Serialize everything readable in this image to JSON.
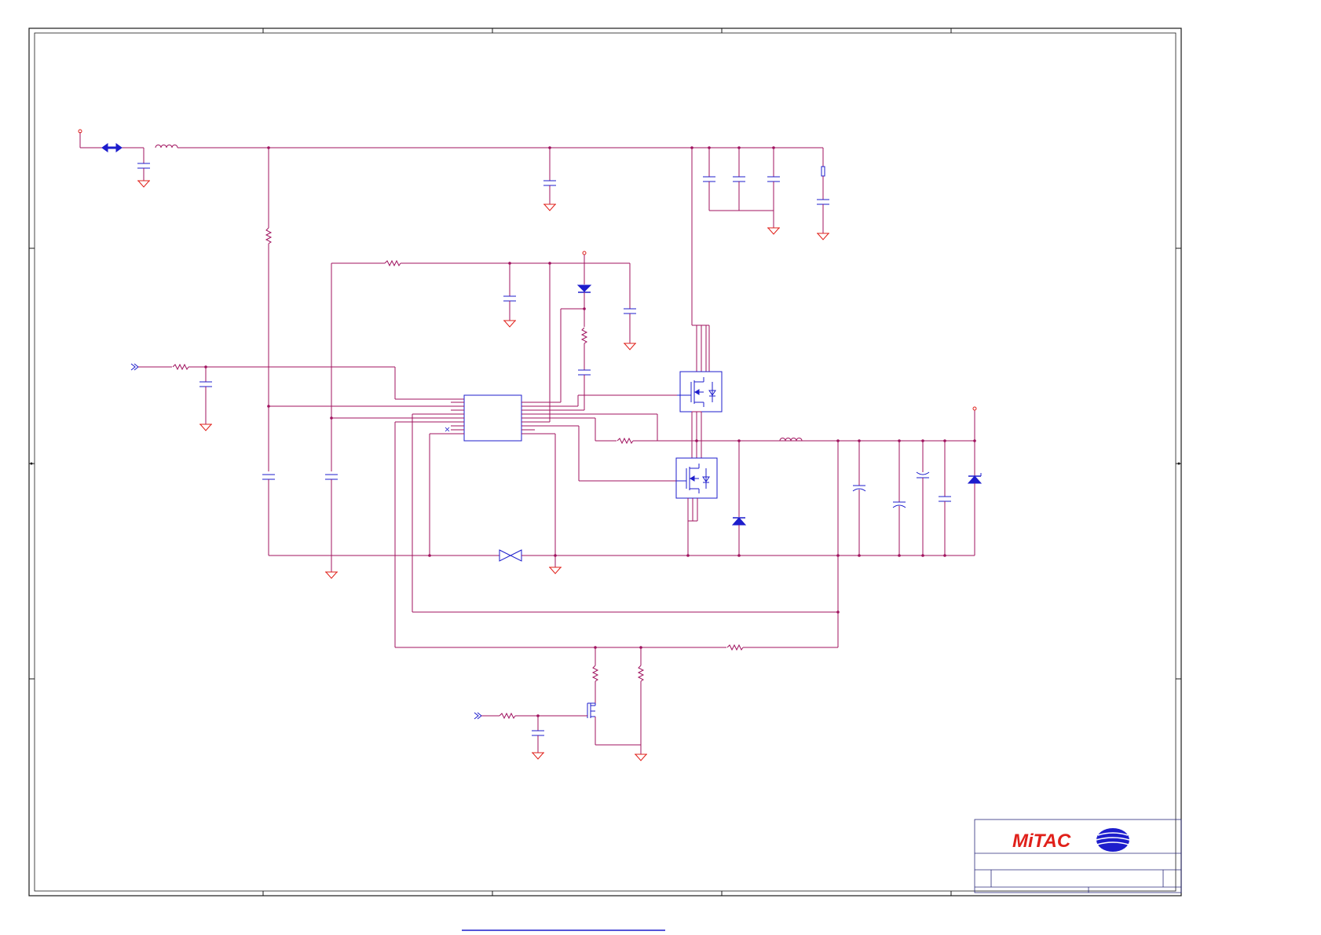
{
  "schematic": {
    "kind": "power-converter-schematic"
  },
  "title_block": {
    "company_logo_text": "MiTAC",
    "logo_emblem": "mitac-globe-icon"
  },
  "colors": {
    "net": "#a0135f",
    "component": "#1d1dcc",
    "ground": "#e0201a",
    "frame": "#1a1a1a",
    "link": "#1d1dcc"
  }
}
